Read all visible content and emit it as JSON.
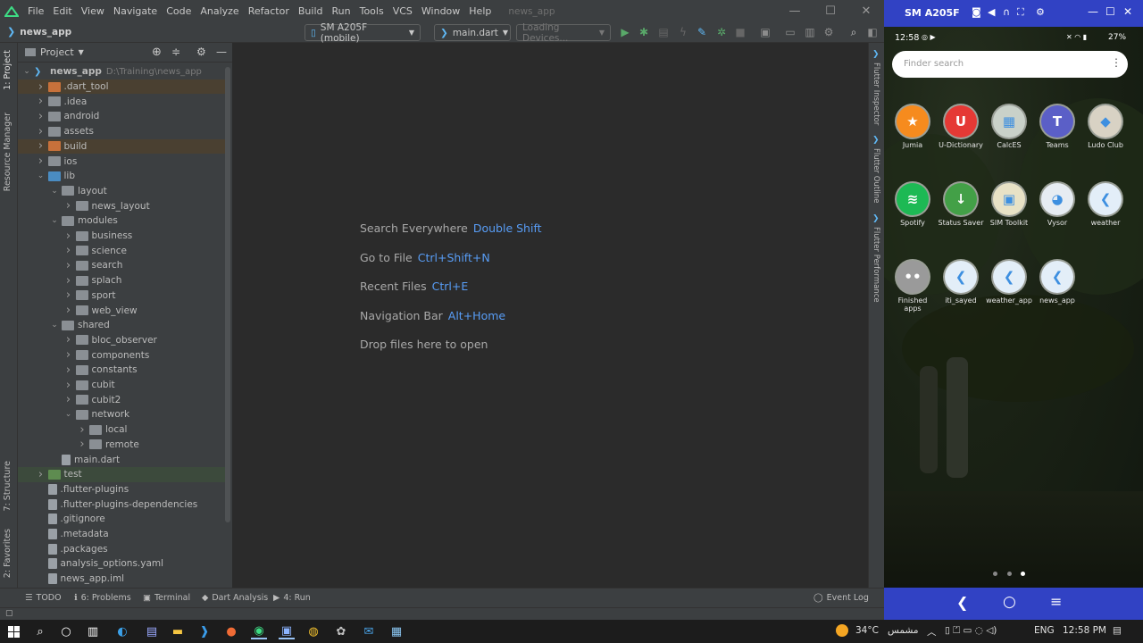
{
  "ide": {
    "menu": [
      "File",
      "Edit",
      "View",
      "Navigate",
      "Code",
      "Analyze",
      "Refactor",
      "Build",
      "Run",
      "Tools",
      "VCS",
      "Window",
      "Help"
    ],
    "project_title": "news_app",
    "breadcrumb": "news_app",
    "device_select": "SM A205F (mobile)",
    "run_config": "main.dart",
    "devices_loading": "Loading Devices...",
    "project_panel_title": "Project",
    "left_tabs": [
      "1: Project",
      "Resource Manager",
      "7: Structure",
      "2: Favorites"
    ],
    "right_tabs": [
      "Flutter Inspector",
      "Flutter Outline",
      "Flutter Performance"
    ],
    "tree": [
      {
        "label": "news_app",
        "sub": "D:\\Training\\news_app",
        "depth": 0,
        "chev": "down",
        "icon": "module",
        "hl": ""
      },
      {
        "label": ".dart_tool",
        "depth": 1,
        "chev": "right",
        "icon": "orange",
        "hl": "orange"
      },
      {
        "label": ".idea",
        "depth": 1,
        "chev": "right",
        "icon": "grey",
        "hl": ""
      },
      {
        "label": "android",
        "depth": 1,
        "chev": "right",
        "icon": "grey",
        "hl": ""
      },
      {
        "label": "assets",
        "depth": 1,
        "chev": "right",
        "icon": "grey",
        "hl": ""
      },
      {
        "label": "build",
        "depth": 1,
        "chev": "right",
        "icon": "orange",
        "hl": "orange"
      },
      {
        "label": "ios",
        "depth": 1,
        "chev": "right",
        "icon": "grey",
        "hl": ""
      },
      {
        "label": "lib",
        "depth": 1,
        "chev": "down",
        "icon": "blue",
        "hl": ""
      },
      {
        "label": "layout",
        "depth": 2,
        "chev": "down",
        "icon": "grey",
        "hl": ""
      },
      {
        "label": "news_layout",
        "depth": 3,
        "chev": "right",
        "icon": "grey",
        "hl": ""
      },
      {
        "label": "modules",
        "depth": 2,
        "chev": "down",
        "icon": "grey",
        "hl": ""
      },
      {
        "label": "business",
        "depth": 3,
        "chev": "right",
        "icon": "grey",
        "hl": ""
      },
      {
        "label": "science",
        "depth": 3,
        "chev": "right",
        "icon": "grey",
        "hl": ""
      },
      {
        "label": "search",
        "depth": 3,
        "chev": "right",
        "icon": "grey",
        "hl": ""
      },
      {
        "label": "splach",
        "depth": 3,
        "chev": "right",
        "icon": "grey",
        "hl": ""
      },
      {
        "label": "sport",
        "depth": 3,
        "chev": "right",
        "icon": "grey",
        "hl": ""
      },
      {
        "label": "web_view",
        "depth": 3,
        "chev": "right",
        "icon": "grey",
        "hl": ""
      },
      {
        "label": "shared",
        "depth": 2,
        "chev": "down",
        "icon": "grey",
        "hl": ""
      },
      {
        "label": "bloc_observer",
        "depth": 3,
        "chev": "right",
        "icon": "grey",
        "hl": ""
      },
      {
        "label": "components",
        "depth": 3,
        "chev": "right",
        "icon": "grey",
        "hl": ""
      },
      {
        "label": "constants",
        "depth": 3,
        "chev": "right",
        "icon": "grey",
        "hl": ""
      },
      {
        "label": "cubit",
        "depth": 3,
        "chev": "right",
        "icon": "grey",
        "hl": ""
      },
      {
        "label": "cubit2",
        "depth": 3,
        "chev": "right",
        "icon": "grey",
        "hl": ""
      },
      {
        "label": "network",
        "depth": 3,
        "chev": "down",
        "icon": "grey",
        "hl": ""
      },
      {
        "label": "local",
        "depth": 4,
        "chev": "right",
        "icon": "grey",
        "hl": ""
      },
      {
        "label": "remote",
        "depth": 4,
        "chev": "right",
        "icon": "grey",
        "hl": ""
      },
      {
        "label": "main.dart",
        "depth": 2,
        "chev": "",
        "icon": "file",
        "hl": ""
      },
      {
        "label": "test",
        "depth": 1,
        "chev": "right",
        "icon": "green",
        "hl": "green"
      },
      {
        "label": ".flutter-plugins",
        "depth": 1,
        "chev": "",
        "icon": "file",
        "hl": ""
      },
      {
        "label": ".flutter-plugins-dependencies",
        "depth": 1,
        "chev": "",
        "icon": "file",
        "hl": ""
      },
      {
        "label": ".gitignore",
        "depth": 1,
        "chev": "",
        "icon": "file",
        "hl": ""
      },
      {
        "label": ".metadata",
        "depth": 1,
        "chev": "",
        "icon": "file",
        "hl": ""
      },
      {
        "label": ".packages",
        "depth": 1,
        "chev": "",
        "icon": "file",
        "hl": ""
      },
      {
        "label": "analysis_options.yaml",
        "depth": 1,
        "chev": "",
        "icon": "file",
        "hl": ""
      },
      {
        "label": "news_app.iml",
        "depth": 1,
        "chev": "",
        "icon": "file",
        "hl": ""
      }
    ],
    "hints": [
      {
        "text": "Search Everywhere",
        "key": "Double Shift"
      },
      {
        "text": "Go to File",
        "key": "Ctrl+Shift+N"
      },
      {
        "text": "Recent Files",
        "key": "Ctrl+E"
      },
      {
        "text": "Navigation Bar",
        "key": "Alt+Home"
      },
      {
        "text": "Drop files here to open",
        "key": ""
      }
    ],
    "bottom_tabs": [
      "TODO",
      "6: Problems",
      "Terminal",
      "Dart Analysis",
      "4: Run"
    ],
    "event_log": "Event Log"
  },
  "phone": {
    "device_name": "SM A205F",
    "time": "12:58",
    "battery": "27%",
    "search_placeholder": "Finder search",
    "apps": [
      {
        "name": "Jumia",
        "color": "#f68b1e",
        "glyph": "★"
      },
      {
        "name": "U-Dictionary",
        "color": "#e53935",
        "glyph": "U"
      },
      {
        "name": "CalcES",
        "color": "#c9d1c9",
        "glyph": "▦"
      },
      {
        "name": "Teams",
        "color": "#5b5fc7",
        "glyph": "T"
      },
      {
        "name": "Ludo Club",
        "color": "#d8d2c4",
        "glyph": "◆"
      },
      {
        "name": "Spotify",
        "color": "#1db954",
        "glyph": "≋"
      },
      {
        "name": "Status Saver",
        "color": "#43a047",
        "glyph": "↓"
      },
      {
        "name": "SIM Toolkit",
        "color": "#e8e2c6",
        "glyph": "▣"
      },
      {
        "name": "Vysor",
        "color": "#e6ecf2",
        "glyph": "◕"
      },
      {
        "name": "weather",
        "color": "#e3eef8",
        "glyph": "❮"
      },
      {
        "name": "Finished apps",
        "color": "#9a9a9a",
        "glyph": "••"
      },
      {
        "name": "iti_sayed",
        "color": "#e3eef8",
        "glyph": "❮"
      },
      {
        "name": "weather_app",
        "color": "#e3eef8",
        "glyph": "❮"
      },
      {
        "name": "news_app",
        "color": "#e3eef8",
        "glyph": "❮"
      }
    ]
  },
  "taskbar": {
    "weather": "34°C",
    "weather_text": "مشمس",
    "lang": "ENG",
    "time": "12:58 PM"
  },
  "colors": {
    "ide_bg": "#2b2b2b",
    "panel_bg": "#3c3f41",
    "key_blue": "#589df6",
    "phone_frame": "#3142c4"
  }
}
